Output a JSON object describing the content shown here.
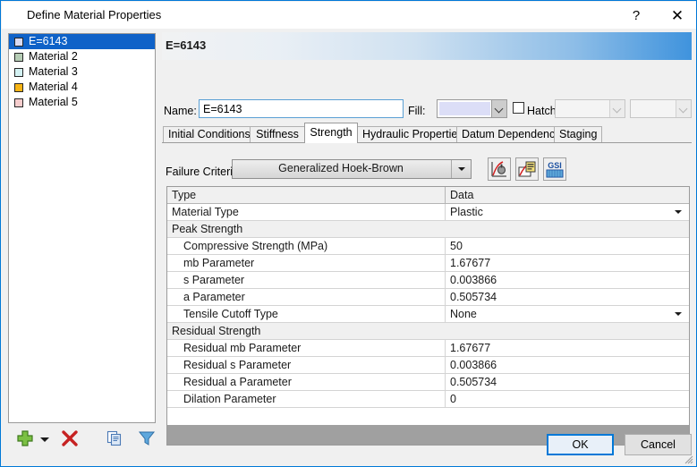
{
  "window": {
    "title": "Define Material Properties",
    "help_label": "?",
    "close_label": "✕",
    "accent_color": "#0078d7"
  },
  "material_list": {
    "items": [
      {
        "label": "E=6143",
        "color": "#d8daf2",
        "selected": true
      },
      {
        "label": "Material 2",
        "color": "#b6cdb6",
        "selected": false
      },
      {
        "label": "Material 3",
        "color": "#d3f1f2",
        "selected": false
      },
      {
        "label": "Material 4",
        "color": "#f7b415",
        "selected": false
      },
      {
        "label": "Material 5",
        "color": "#f6cdcd",
        "selected": false
      }
    ]
  },
  "banner": {
    "title": "E=6143"
  },
  "name_row": {
    "label": "Name:",
    "value": "E=6143",
    "fill_label": "Fill:",
    "fill_color": "#dcdef7",
    "hatch_label": "Hatch:",
    "hatch_checked": false
  },
  "tabs": [
    {
      "label": "Initial Conditions",
      "active": false
    },
    {
      "label": "Stiffness",
      "active": false
    },
    {
      "label": "Strength",
      "active": true
    },
    {
      "label": "Hydraulic Properties",
      "active": false
    },
    {
      "label": "Datum Dependency",
      "active": false
    },
    {
      "label": "Staging",
      "active": false
    }
  ],
  "failure_criterion": {
    "label": "Failure Criterion:",
    "value": "Generalized Hoek-Brown",
    "buttons": [
      {
        "name": "strength-plot-icon"
      },
      {
        "name": "rocdata-icon"
      },
      {
        "name": "gsi-chart-icon",
        "label": "GSI"
      }
    ]
  },
  "grid": {
    "headers": {
      "type": "Type",
      "data": "Data"
    },
    "rows": [
      {
        "kind": "row",
        "indent": 0,
        "type": "Material Type",
        "data": "Plastic",
        "dropdown": true
      },
      {
        "kind": "group",
        "indent": 0,
        "type": "Peak Strength",
        "data": "",
        "dropdown": false
      },
      {
        "kind": "row",
        "indent": 1,
        "type": "Compressive Strength (MPa)",
        "data": "50",
        "dropdown": false
      },
      {
        "kind": "row",
        "indent": 1,
        "type": "mb Parameter",
        "data": "1.67677",
        "dropdown": false
      },
      {
        "kind": "row",
        "indent": 1,
        "type": "s Parameter",
        "data": "0.003866",
        "dropdown": false
      },
      {
        "kind": "row",
        "indent": 1,
        "type": "a Parameter",
        "data": "0.505734",
        "dropdown": false
      },
      {
        "kind": "row",
        "indent": 1,
        "type": "Tensile Cutoff Type",
        "data": "None",
        "dropdown": true
      },
      {
        "kind": "group",
        "indent": 0,
        "type": "Residual Strength",
        "data": "",
        "dropdown": false
      },
      {
        "kind": "row",
        "indent": 1,
        "type": "Residual mb Parameter",
        "data": "1.67677",
        "dropdown": false
      },
      {
        "kind": "row",
        "indent": 1,
        "type": "Residual s Parameter",
        "data": "0.003866",
        "dropdown": false
      },
      {
        "kind": "row",
        "indent": 1,
        "type": "Residual a Parameter",
        "data": "0.505734",
        "dropdown": false
      },
      {
        "kind": "row",
        "indent": 1,
        "type": "Dilation Parameter",
        "data": "0",
        "dropdown": false
      }
    ]
  },
  "bottom_toolbar": {
    "add": "add-icon",
    "add_dropdown": "chevron-down-icon",
    "delete": "delete-icon",
    "copy": "copy-icon",
    "filter": "filter-icon"
  },
  "dialog_buttons": {
    "ok": "OK",
    "cancel": "Cancel"
  }
}
